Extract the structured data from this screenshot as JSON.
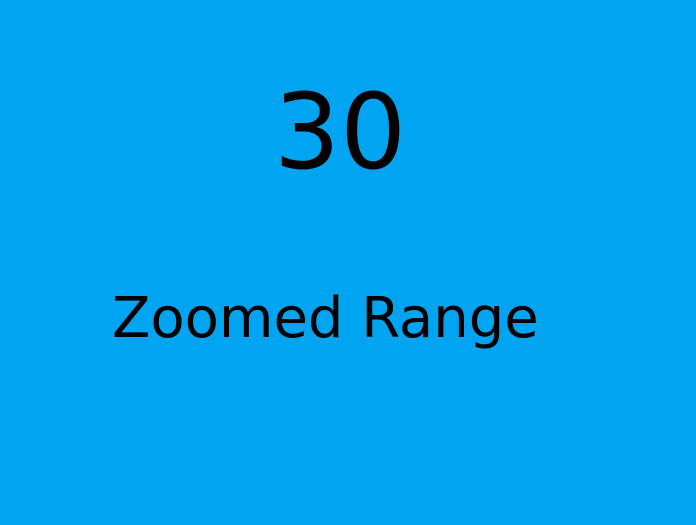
{
  "tile": {
    "value": "30",
    "label": "Zoomed Range",
    "background_color": "#00A4F0",
    "text_color": "#000000"
  }
}
